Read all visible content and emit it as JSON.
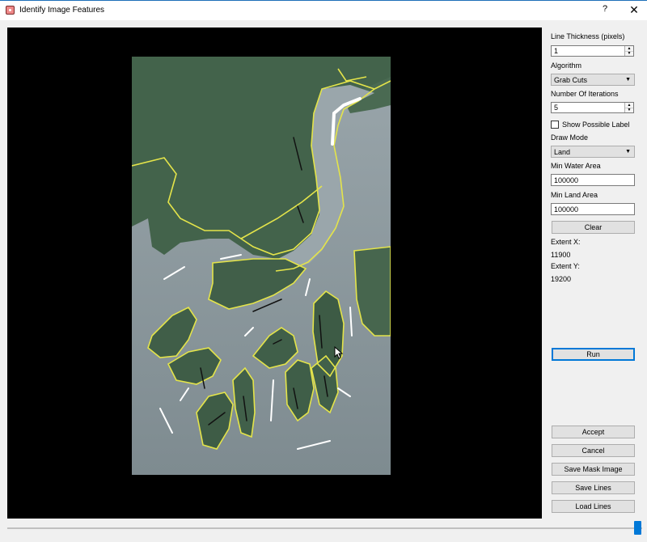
{
  "window": {
    "title": "Identify Image Features",
    "help_label": "?",
    "close_label": "✕",
    "app_icon": "app-icon"
  },
  "panel": {
    "line_thickness_label": "Line Thickness (pixels)",
    "line_thickness_value": "1",
    "algorithm_label": "Algorithm",
    "algorithm_value": "Grab Cuts",
    "iterations_label": "Number Of Iterations",
    "iterations_value": "5",
    "show_possible_label": "Show Possible Label",
    "show_possible_checked": false,
    "draw_mode_label": "Draw Mode",
    "draw_mode_value": "Land",
    "min_water_label": "Min Water Area",
    "min_water_value": "100000",
    "min_land_label": "Min Land Area",
    "min_land_value": "100000",
    "clear_label": "Clear",
    "extent_x_label": "Extent X:",
    "extent_x_value": "11900",
    "extent_y_label": "Extent Y:",
    "extent_y_value": "19200",
    "run_label": "Run",
    "accept_label": "Accept",
    "cancel_label": "Cancel",
    "save_mask_label": "Save Mask Image",
    "save_lines_label": "Save Lines",
    "load_lines_label": "Load Lines"
  },
  "slider": {
    "value_fraction": 1.0,
    "accent": "#0078d7"
  },
  "colors": {
    "outline": "#e4e44a",
    "water": "#8d9aa0",
    "land": "#3f6048",
    "water_stroke": "#ffffff",
    "land_stroke": "#111111"
  }
}
